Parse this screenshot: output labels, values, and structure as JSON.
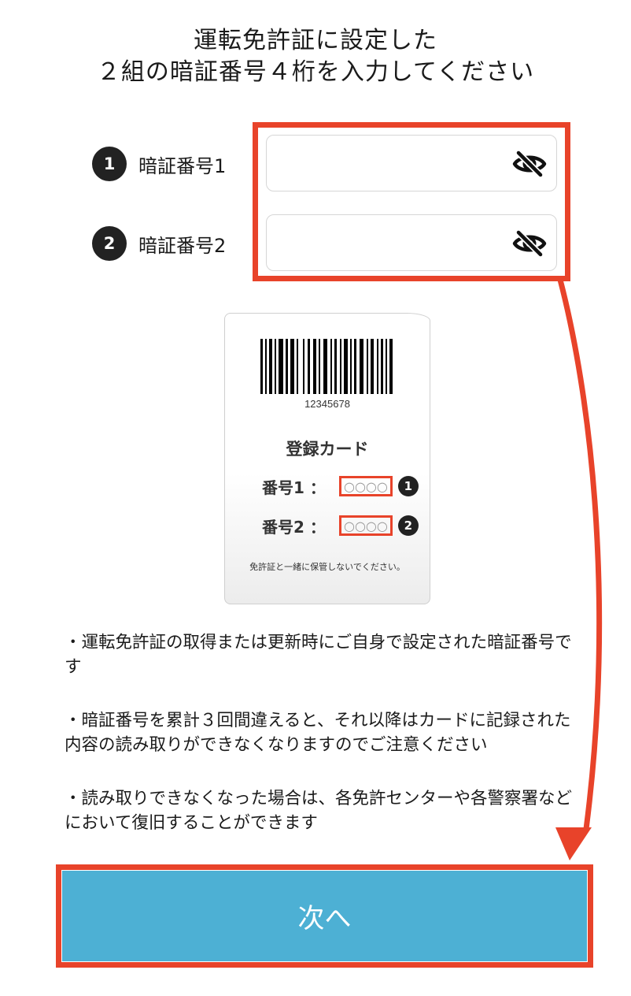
{
  "header": {
    "title_line1": "運転免許証に設定した",
    "title_line2": "２組の暗証番号４桁を入力してください"
  },
  "fields": [
    {
      "number": "1",
      "label": "暗証番号1",
      "value": "",
      "visibility_icon": "eye-off-icon"
    },
    {
      "number": "2",
      "label": "暗証番号2",
      "value": "",
      "visibility_icon": "eye-off-icon"
    }
  ],
  "card": {
    "barcode_number": "12345678",
    "title": "登録カード",
    "rows": [
      {
        "label": "番号1 ：",
        "digits": "○○○○",
        "number": "1"
      },
      {
        "label": "番号2 ：",
        "digits": "○○○○",
        "number": "2"
      }
    ],
    "note": "免許証と一緒に保管しないでください。"
  },
  "notes": [
    "・運転免許証の取得または更新時にご自身で設定された暗証番号です",
    "・暗証番号を累計３回間違えると、それ以降はカードに記録された内容の読み取りができなくなりますのでご注意ください",
    "・読み取りできなくなった場合は、各免許センターや各警察署などにおいて復旧することができます"
  ],
  "next_button": {
    "label": "次へ"
  },
  "colors": {
    "highlight": "#e8432a",
    "button": "#4db0d4",
    "circle": "#222222"
  }
}
